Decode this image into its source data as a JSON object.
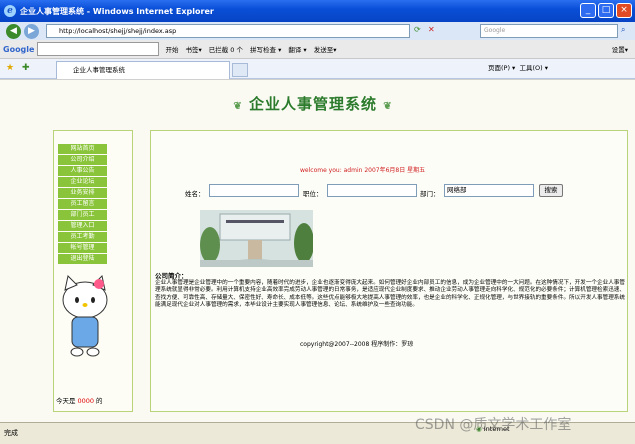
{
  "window": {
    "title": "企业人事管理系统 - Windows Internet Explorer",
    "controls": [
      "_",
      "□",
      "×"
    ]
  },
  "address_bar": {
    "url": "http://localhost/shejj/shejj/index.asp",
    "search_placeholder": "Google"
  },
  "google_toolbar": {
    "logo": "Google",
    "items": [
      "开始",
      "书签▾",
      "已拦截 0 个",
      "拼写检查 ▾",
      "翻译 ▾",
      "发送至▾"
    ],
    "settings": "设置▾"
  },
  "tab": {
    "title": "企业人事管理系统",
    "tools": [
      "页面(P) ▾",
      "工具(O) ▾"
    ]
  },
  "page": {
    "banner": "企业人事管理系统",
    "nav": [
      "网站首页",
      "公司介绍",
      "人事公告",
      "企业论坛",
      "业务安排",
      "员工留言",
      "部门员工",
      "管理入口",
      "员工考勤",
      "帐号管理",
      "退出登陆"
    ],
    "counter": {
      "prefix": "今天是",
      "value": "0000",
      "suffix": "的"
    },
    "welcome": "welcome you: admin  2007年6月8日 星期五",
    "search": {
      "name_label": "姓名：",
      "position_label": "职位：",
      "dept_label": "部门：",
      "dept_value": "网络部",
      "button": "搜索"
    },
    "intro_title": "公司简介：",
    "intro_text": "企业人事管理是企业管理中的一个重要内容，随着时代的进步，企业也逐渐变得庞大起来。如何管理好企业内部员工的信息，成为企业管理中的一大问题。在这种情况下，开发一个企业人事管理系统就显得非常必要。利用计算机支持企业高效率完成劳动人事管理的日常事务，是适应现代企业制度要求、推动企业劳动人事管理走向科学化、规范化的必要条件；计算机管理检索迅速、查找方便、可靠性高、存储量大、保密性好、寿命长、成本低等。这些优点能够极大地提高人事管理的效率，也是企业的科学化、正规化管理，与世界接轨的重要条件。所以开发人事管理系统能满足现代企业对人事管理的需求，本毕业设计主要实现人事管理信息、论坛、系统维护及一些查询功能。",
    "copyright": "copyright@2007--2008 程序制作：罗琼"
  },
  "status_bar": {
    "text": "完成",
    "zone": "Internet",
    "watermark": "CSDN @质文学术工作室"
  },
  "colors": {
    "titlebar": "#0a4fd8",
    "nav": "#8ac43a",
    "banner": "#2c7b2c",
    "border": "#b9d37a"
  }
}
